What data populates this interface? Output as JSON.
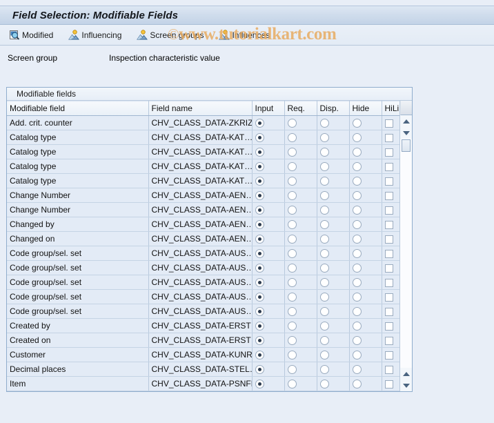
{
  "window": {
    "title": "Field Selection: Modifiable Fields"
  },
  "toolbar": {
    "buttons": [
      {
        "label": "Modified",
        "icon": "magnifier-document-icon"
      },
      {
        "label": "Influencing",
        "icon": "influence-person-icon"
      },
      {
        "label": "Screen groups",
        "icon": "influence-person-icon"
      },
      {
        "label": "Influences",
        "icon": "influence-person-icon"
      }
    ]
  },
  "watermark": {
    "copyright": "©",
    "text": "www.tutorialkart.com",
    "color": "#e8a95c"
  },
  "screen_group": {
    "label": "Screen group",
    "value": "Inspection characteristic value"
  },
  "panel": {
    "title": "Modifiable fields",
    "columns": [
      "Modifiable field",
      "Field name",
      "Input",
      "Req.",
      "Disp.",
      "Hide",
      "HiLi"
    ],
    "rows": [
      {
        "field": "Add. crit. counter",
        "name": "CHV_CLASS_DATA-ZKRIZ",
        "input": true,
        "req": false,
        "disp": false,
        "hide": false,
        "hili": false
      },
      {
        "field": "Catalog type",
        "name": "CHV_CLASS_DATA-KAT…",
        "input": true,
        "req": false,
        "disp": false,
        "hide": false,
        "hili": false
      },
      {
        "field": "Catalog type",
        "name": "CHV_CLASS_DATA-KAT…",
        "input": true,
        "req": false,
        "disp": false,
        "hide": false,
        "hili": false
      },
      {
        "field": "Catalog type",
        "name": "CHV_CLASS_DATA-KAT…",
        "input": true,
        "req": false,
        "disp": false,
        "hide": false,
        "hili": false
      },
      {
        "field": "Catalog type",
        "name": "CHV_CLASS_DATA-KAT…",
        "input": true,
        "req": false,
        "disp": false,
        "hide": false,
        "hili": false
      },
      {
        "field": "Change Number",
        "name": "CHV_CLASS_DATA-AEN…",
        "input": true,
        "req": false,
        "disp": false,
        "hide": false,
        "hili": false
      },
      {
        "field": "Change Number",
        "name": "CHV_CLASS_DATA-AEN…",
        "input": true,
        "req": false,
        "disp": false,
        "hide": false,
        "hili": false
      },
      {
        "field": "Changed by",
        "name": "CHV_CLASS_DATA-AEN…",
        "input": true,
        "req": false,
        "disp": false,
        "hide": false,
        "hili": false
      },
      {
        "field": "Changed on",
        "name": "CHV_CLASS_DATA-AEN…",
        "input": true,
        "req": false,
        "disp": false,
        "hide": false,
        "hili": false
      },
      {
        "field": "Code group/sel. set",
        "name": "CHV_CLASS_DATA-AUS…",
        "input": true,
        "req": false,
        "disp": false,
        "hide": false,
        "hili": false
      },
      {
        "field": "Code group/sel. set",
        "name": "CHV_CLASS_DATA-AUS…",
        "input": true,
        "req": false,
        "disp": false,
        "hide": false,
        "hili": false
      },
      {
        "field": "Code group/sel. set",
        "name": "CHV_CLASS_DATA-AUS…",
        "input": true,
        "req": false,
        "disp": false,
        "hide": false,
        "hili": false
      },
      {
        "field": "Code group/sel. set",
        "name": "CHV_CLASS_DATA-AUS…",
        "input": true,
        "req": false,
        "disp": false,
        "hide": false,
        "hili": false
      },
      {
        "field": "Code group/sel. set",
        "name": "CHV_CLASS_DATA-AUS…",
        "input": true,
        "req": false,
        "disp": false,
        "hide": false,
        "hili": false
      },
      {
        "field": "Created by",
        "name": "CHV_CLASS_DATA-ERST…",
        "input": true,
        "req": false,
        "disp": false,
        "hide": false,
        "hili": false
      },
      {
        "field": "Created on",
        "name": "CHV_CLASS_DATA-ERST…",
        "input": true,
        "req": false,
        "disp": false,
        "hide": false,
        "hili": false
      },
      {
        "field": "Customer",
        "name": "CHV_CLASS_DATA-KUNR",
        "input": true,
        "req": false,
        "disp": false,
        "hide": false,
        "hili": false
      },
      {
        "field": "Decimal places",
        "name": "CHV_CLASS_DATA-STEL…",
        "input": true,
        "req": false,
        "disp": false,
        "hide": false,
        "hili": false
      },
      {
        "field": "Item",
        "name": "CHV_CLASS_DATA-PSNFH",
        "input": true,
        "req": false,
        "disp": false,
        "hide": false,
        "hili": false
      }
    ]
  },
  "scrollbar": {
    "up_arrow": "scroll-up-icon",
    "down_arrow": "scroll-down-icon"
  }
}
